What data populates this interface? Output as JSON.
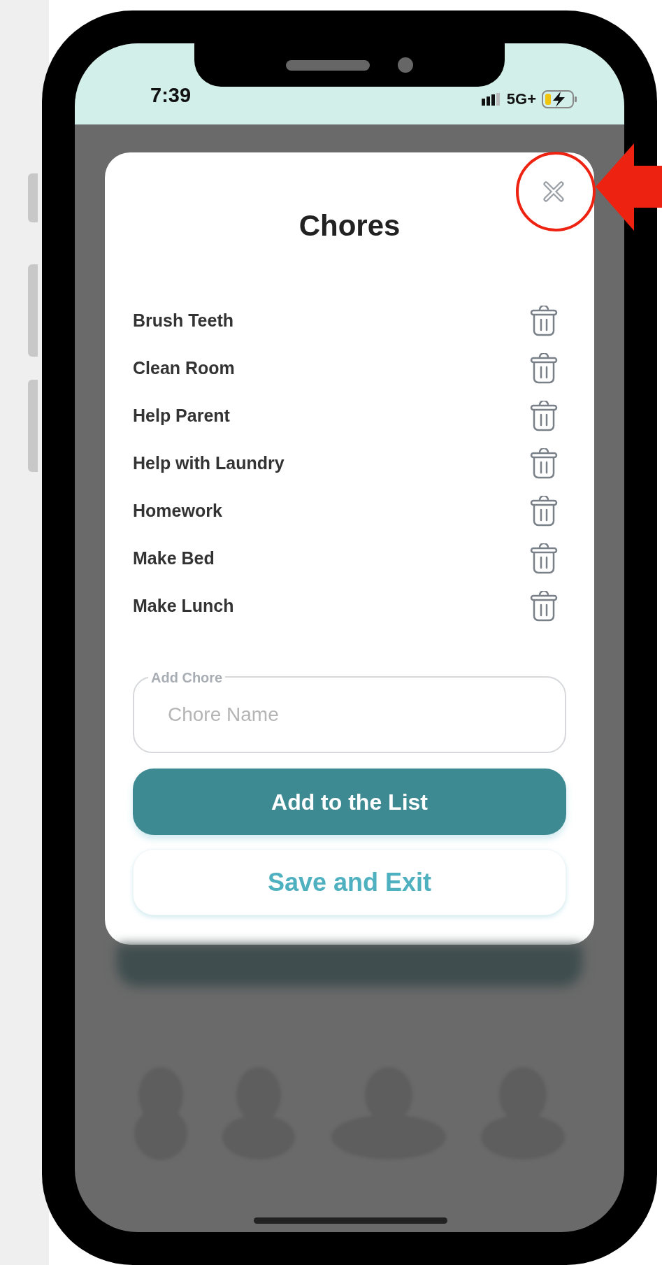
{
  "status_bar": {
    "time": "7:39",
    "network": "5G+"
  },
  "modal": {
    "title": "Chores",
    "chores": [
      {
        "name": "Brush Teeth"
      },
      {
        "name": "Clean Room"
      },
      {
        "name": "Help Parent"
      },
      {
        "name": "Help with Laundry"
      },
      {
        "name": "Homework"
      },
      {
        "name": "Make Bed"
      },
      {
        "name": "Make Lunch"
      }
    ],
    "field": {
      "label": "Add Chore",
      "placeholder": "Chore Name"
    },
    "buttons": [
      {
        "label": "Add to the List",
        "kind": "primary"
      },
      {
        "label": "Save and Exit",
        "kind": "secondary"
      }
    ]
  }
}
